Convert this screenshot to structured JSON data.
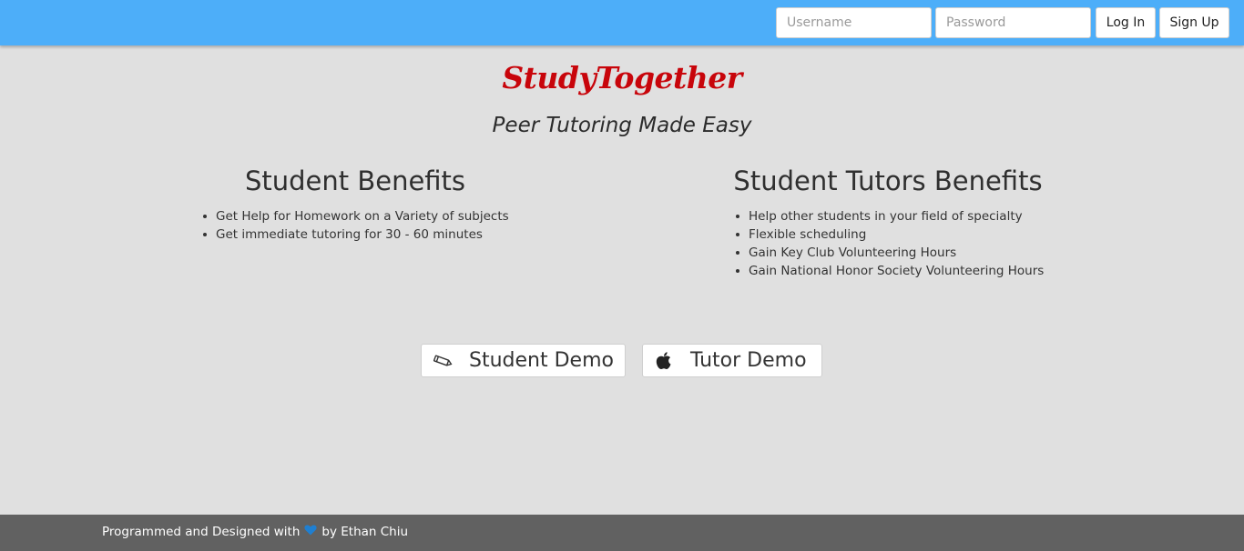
{
  "navbar": {
    "username_placeholder": "Username",
    "password_placeholder": "Password",
    "login_label": "Log In",
    "signup_label": "Sign Up",
    "background_color": "#4daef9"
  },
  "brand": {
    "title": "StudyTogether",
    "color": "#c8050b"
  },
  "tagline": "Peer Tutoring Made Easy",
  "student_benefits": {
    "title": "Student Benefits",
    "items": [
      "Get Help for Homework on a Variety of subjects",
      "Get immediate tutoring for 30 - 60 minutes"
    ]
  },
  "tutor_benefits": {
    "title": "Student Tutors Benefits",
    "items": [
      "Help other students in your field of specialty",
      "Flexible scheduling",
      "Gain Key Club Volunteering Hours",
      "Gain National Honor Society Volunteering Hours"
    ]
  },
  "demos": {
    "student_label": "Student Demo",
    "student_icon": "pencil-icon",
    "tutor_label": "Tutor Demo",
    "tutor_icon": "apple-icon"
  },
  "footer": {
    "prefix": "Programmed and Designed with",
    "heart_icon": "heart-icon",
    "heart_color": "#1f7fd1",
    "suffix": "by Ethan Chiu",
    "background_color": "#616161"
  }
}
